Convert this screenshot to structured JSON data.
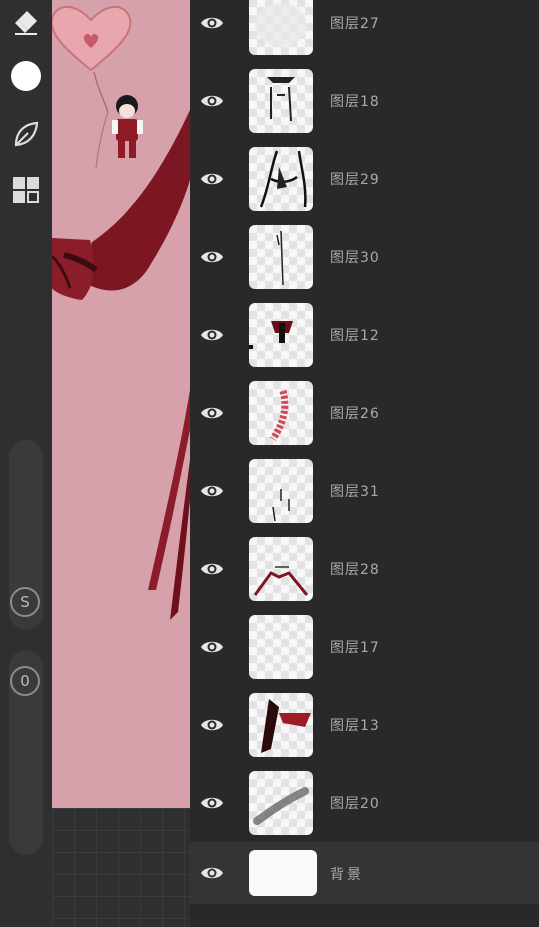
{
  "tools": {
    "eraser_icon": "eraser-icon",
    "color_icon": "color-circle-icon",
    "brush_icon": "leaf-brush-icon",
    "layers_icon": "layers-grid-icon",
    "size_knob_label": "S",
    "opacity_knob_label": "0"
  },
  "layers": [
    {
      "name": "图层27"
    },
    {
      "name": "图层18"
    },
    {
      "name": "图层29"
    },
    {
      "name": "图层30"
    },
    {
      "name": "图层12"
    },
    {
      "name": "图层26"
    },
    {
      "name": "图层31"
    },
    {
      "name": "图层28"
    },
    {
      "name": "图层17"
    },
    {
      "name": "图层13"
    },
    {
      "name": "图层20"
    }
  ],
  "background_layer": {
    "name": "背景"
  },
  "colors": {
    "canvas_pink": "#d6a1aa",
    "drawing_red": "#7b1622",
    "panel_bg": "#29292b"
  }
}
